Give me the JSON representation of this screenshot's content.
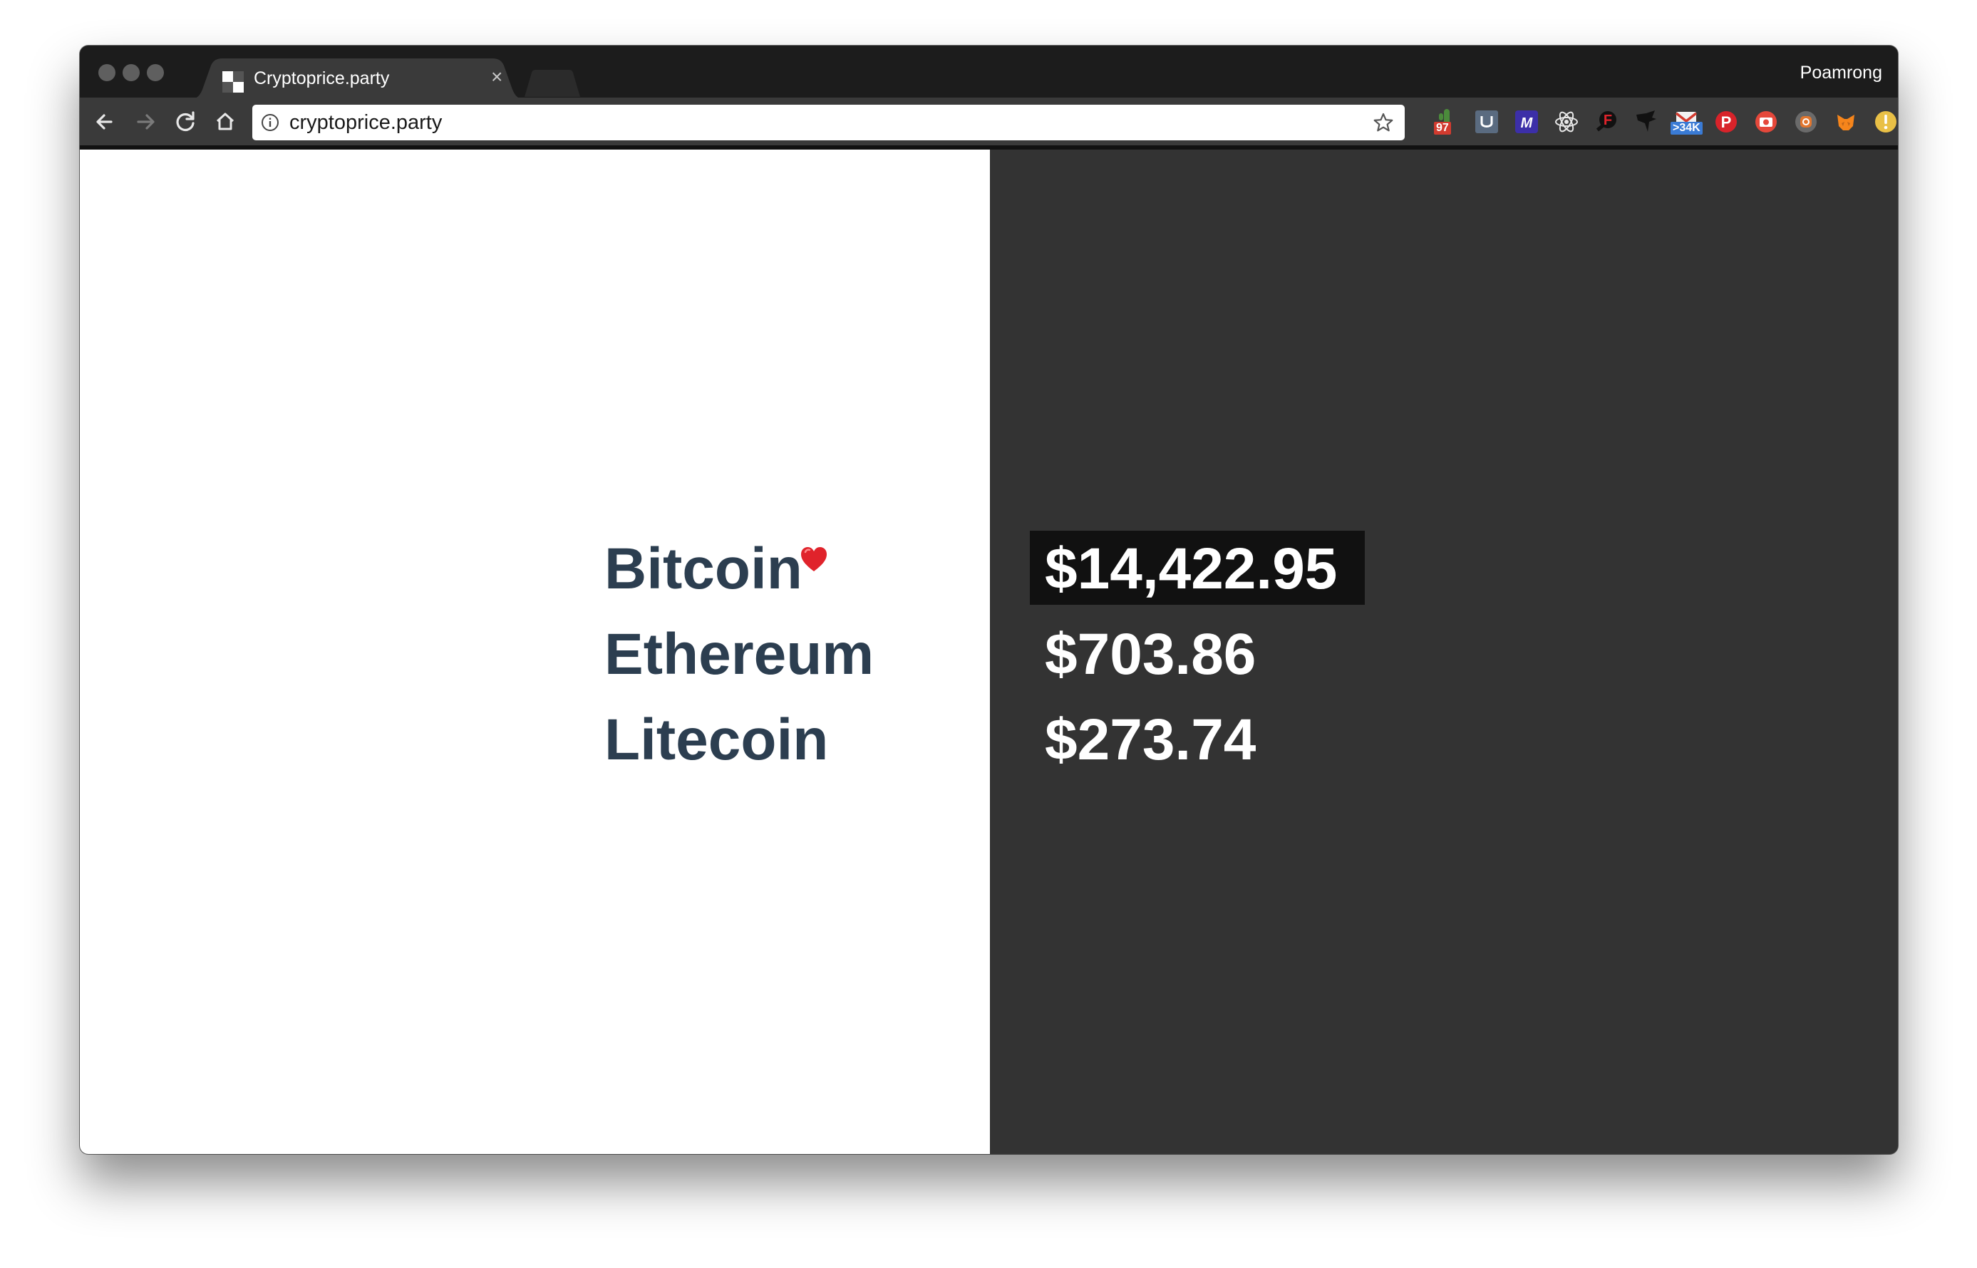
{
  "browser": {
    "tab_title": "Cryptoprice.party",
    "tab_close": "×",
    "profile_name": "Poamrong",
    "url": "cryptoprice.party"
  },
  "toolbar": {
    "back_icon": "arrow-left-icon",
    "forward_icon": "arrow-right-icon",
    "reload_icon": "reload-icon",
    "home_icon": "home-icon",
    "bookmark_icon": "star-icon"
  },
  "extensions": [
    {
      "name": "cactus-extension",
      "badge": "97",
      "badge_color": "#d23b2f"
    },
    {
      "name": "ublock-extension",
      "badge": ""
    },
    {
      "name": "m-extension",
      "badge": ""
    },
    {
      "name": "react-devtools-extension",
      "badge": ""
    },
    {
      "name": "f-extension",
      "badge": ""
    },
    {
      "name": "bird-extension",
      "badge": ""
    },
    {
      "name": "gmail-checker-extension",
      "badge": ">34K",
      "badge_color": "#3a7bd5"
    },
    {
      "name": "pinterest-extension",
      "badge": ""
    },
    {
      "name": "camera-extension",
      "badge": ""
    },
    {
      "name": "instagram-extension",
      "badge": ""
    },
    {
      "name": "metamask-extension",
      "badge": ""
    },
    {
      "name": "alert-extension",
      "badge": ""
    }
  ],
  "coins": [
    {
      "name": "Bitcoin",
      "price": "$14,422.95",
      "favorite": true
    },
    {
      "name": "Ethereum",
      "price": "$703.86",
      "favorite": false
    },
    {
      "name": "Litecoin",
      "price": "$273.74",
      "favorite": false
    }
  ],
  "colors": {
    "coin_name": "#2c3e50",
    "left_bg": "#ffffff",
    "right_bg": "#333333",
    "highlight_bg": "#111111",
    "price_text": "#ffffff",
    "heart": "#e0232b"
  }
}
